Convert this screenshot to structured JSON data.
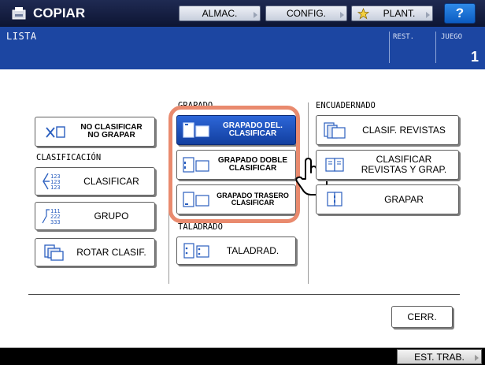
{
  "header": {
    "app_title": "COPIAR",
    "buttons": {
      "almac": "ALMAC.",
      "config": "CONFIG.",
      "plant": "PLANT.",
      "help": "?"
    }
  },
  "infobar": {
    "title": "LISTA",
    "rest_label": "REST.",
    "juego_label": "JUEGO",
    "juego_value": "1"
  },
  "sections": {
    "clasificacion": "CLASIFICACIÓN",
    "grapado": "GRAPADO",
    "taladrado": "TALADRADO",
    "encuadernado": "ENCUADERNADO"
  },
  "buttons": {
    "no_clasificar_l1": "NO CLASIFICAR",
    "no_clasificar_l2": "NO GRAPAR",
    "clasificar": "CLASIFICAR",
    "grupo": "GRUPO",
    "rotar_clasif": "ROTAR CLASIF.",
    "grapado_del_l1": "GRAPADO DEL.",
    "grapado_del_l2": "CLASIFICAR",
    "grapado_doble_l1": "GRAPADO DOBLE",
    "grapado_doble_l2": "CLASIFICAR",
    "grapado_trasero_l1": "GRAPADO TRASERO",
    "grapado_trasero_l2": "CLASIFICAR",
    "taladrad": "TALADRAD.",
    "clasif_revistas": "CLASIF. REVISTAS",
    "clasificar_revistas_l1": "CLASIFICAR",
    "clasificar_revistas_l2": "REVISTAS Y GRAP.",
    "grapar": "GRAPAR",
    "cerr": "CERR."
  },
  "icon_glyphs": {
    "clasificar": [
      "123",
      "123",
      "123"
    ],
    "grupo": [
      "111",
      "222",
      "333"
    ]
  },
  "footer": {
    "status_button": "EST. TRAB."
  },
  "colors": {
    "header_bg": "#0d1533",
    "info_bg": "#1c46a2",
    "selected_button": "#1f4fc0",
    "highlight_frame": "#e98a6e",
    "help_button": "#1570d8"
  },
  "state": {
    "selected_option": "GRAPADO DEL. CLASIFICAR"
  }
}
